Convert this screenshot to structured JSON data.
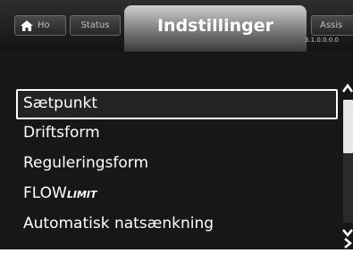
{
  "tabs": {
    "home": {
      "label": "Ho",
      "icon": "home-icon"
    },
    "status": {
      "label": "Status"
    },
    "active": {
      "label": "Indstillinger"
    },
    "assist": {
      "label": "Assis"
    }
  },
  "menu_code": "3.1.0.0.0.0",
  "menu": {
    "items": [
      {
        "label": "Sætpunkt",
        "selected": true
      },
      {
        "label": "Driftsform"
      },
      {
        "label": "Reguleringsform"
      },
      {
        "label_main": "FLOW",
        "label_sub": "LIMIT"
      },
      {
        "label": "Automatisk natsænkning"
      }
    ]
  },
  "scroll": {
    "position_fraction": 0.0,
    "visible_fraction": 0.43
  },
  "colors": {
    "background": "#171717",
    "text": "#ffffff",
    "selection_border": "#ffffff",
    "active_tab_top": "#cfcfcf"
  }
}
